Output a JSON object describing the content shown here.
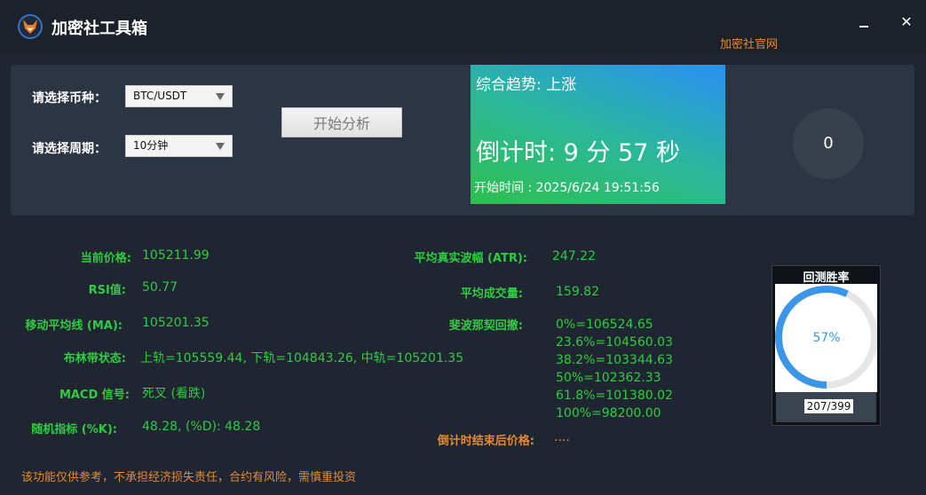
{
  "window": {
    "title": "加密社工具箱",
    "minimize": "",
    "close": "✕",
    "official_link": "加密社官网"
  },
  "controls": {
    "coin_label": "请选择币种：",
    "coin_value": "BTC/USDT",
    "period_label": "请选择周期：",
    "period_value": "10分钟",
    "start_button": "开始分析"
  },
  "trend": {
    "trend_text": "综合趋势: 上涨",
    "countdown": "倒计时: 9 分 57 秒",
    "start_time": "开始时间 : 2025/6/24 19:51:56"
  },
  "counter": "0",
  "metrics": {
    "price_label": "当前价格:",
    "price_value": "105211.99",
    "rsi_label": "RSI值:",
    "rsi_value": "50.77",
    "ma_label": "移动平均线 (MA):",
    "ma_value": "105201.35",
    "boll_label": "布林带状态:",
    "boll_value": "上轨=105559.44, 下轨=104843.26, 中轨=105201.35",
    "macd_label": "MACD 信号:",
    "macd_value": "死叉 (看跌)",
    "kdj_label": "随机指标 (%K):",
    "kdj_value": "48.28, (%D): 48.28",
    "atr_label": "平均真实波幅 (ATR):",
    "atr_value": "247.22",
    "volume_label": "平均成交量:",
    "volume_value": "159.82",
    "fib_label": "斐波那契回撤:",
    "fib_values": [
      "0%=106524.65",
      "23.6%=104560.03",
      "38.2%=103344.63",
      "50%=102362.33",
      "61.8%=101380.02",
      "100%=98200.00"
    ],
    "end_price_label": "倒计时结束后价格:",
    "end_price_value": "...."
  },
  "backtest": {
    "title": "回测胜率",
    "percent_text": "57%",
    "percent": 57,
    "count": "207/399"
  },
  "footer": "该功能仅供参考，不承担经济损失责任，合约有风险，需慎重投资",
  "colors": {
    "accent_green": "#2ecc40",
    "accent_orange": "#e58a2e",
    "ring_blue": "#3b96e8"
  }
}
